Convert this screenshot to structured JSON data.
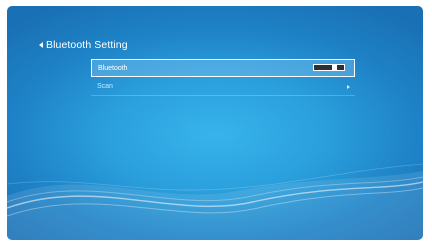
{
  "header": {
    "title": "Bluetooth Setting",
    "back_icon": "chevron-left-icon"
  },
  "menu": {
    "items": [
      {
        "label": "Bluetooth",
        "control": "toggle",
        "toggle_state": "on",
        "selected": true
      },
      {
        "label": "Scan",
        "control": "chevron-right-icon",
        "selected": false
      }
    ]
  },
  "colors": {
    "background_center": "#38b4ec",
    "background_edge": "#1a70b4",
    "text": "#ffffff",
    "toggle_track": "#2b2f38"
  }
}
